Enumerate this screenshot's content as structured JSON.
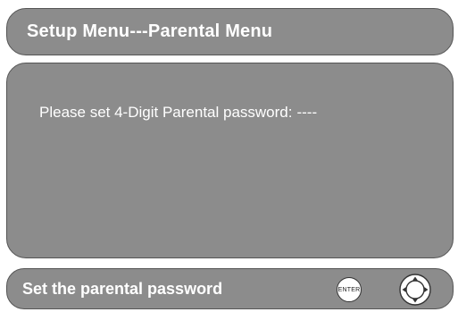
{
  "header": {
    "title": "Setup Menu---Parental Menu"
  },
  "content": {
    "prompt": "Please set 4-Digit Parental password:",
    "password_mask": "----"
  },
  "footer": {
    "hint": "Set the parental password",
    "enter_label": "ENTER",
    "enter_icon": "enter-button-icon",
    "nav_icon": "directional-pad-icon"
  },
  "colors": {
    "panel_fill": "#8c8c8c",
    "panel_border": "#555555",
    "text": "#ffffff"
  }
}
